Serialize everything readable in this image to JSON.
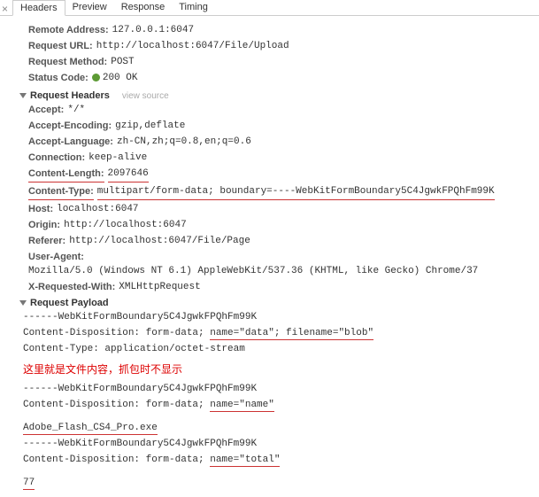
{
  "tabs": {
    "headers": "Headers",
    "preview": "Preview",
    "response": "Response",
    "timing": "Timing"
  },
  "general": {
    "remoteAddress": {
      "label": "Remote Address:",
      "value": "127.0.0.1:6047"
    },
    "requestUrl": {
      "label": "Request URL:",
      "value": "http://localhost:6047/File/Upload"
    },
    "requestMethod": {
      "label": "Request Method:",
      "value": "POST"
    },
    "statusCode": {
      "label": "Status Code:",
      "value": "200 OK"
    }
  },
  "requestHeaders": {
    "title": "Request Headers",
    "viewSource": "view source",
    "accept": {
      "label": "Accept:",
      "value": "*/*"
    },
    "acceptEncoding": {
      "label": "Accept-Encoding:",
      "value": "gzip,deflate"
    },
    "acceptLanguage": {
      "label": "Accept-Language:",
      "value": "zh-CN,zh;q=0.8,en;q=0.6"
    },
    "connection": {
      "label": "Connection:",
      "value": "keep-alive"
    },
    "contentLength": {
      "label": "Content-Length:",
      "value": "2097646"
    },
    "contentType": {
      "label": "Content-Type:",
      "value": "multipart/form-data; boundary=----WebKitFormBoundary5C4JgwkFPQhFm99K"
    },
    "host": {
      "label": "Host:",
      "value": "localhost:6047"
    },
    "origin": {
      "label": "Origin:",
      "value": "http://localhost:6047"
    },
    "referer": {
      "label": "Referer:",
      "value": "http://localhost:6047/File/Page"
    },
    "userAgent": {
      "label": "User-Agent:",
      "value": "Mozilla/5.0 (Windows NT 6.1) AppleWebKit/537.36 (KHTML, like Gecko) Chrome/37"
    },
    "xRequestedWith": {
      "label": "X-Requested-With:",
      "value": "XMLHttpRequest"
    }
  },
  "requestPayload": {
    "title": "Request Payload",
    "boundary1": "------WebKitFormBoundary5C4JgwkFPQhFm99K",
    "disp1_prefix": "Content-Disposition: form-data; ",
    "disp1_name": "name=\"data\"; filename=\"blob\"",
    "ctype1": "Content-Type: application/octet-stream",
    "note": "这里就是文件内容，抓包时不显示",
    "boundary2": "------WebKitFormBoundary5C4JgwkFPQhFm99K",
    "disp2_prefix": "Content-Disposition: form-data; ",
    "disp2_name": "name=\"name\"",
    "filename": "Adobe_Flash_CS4_Pro.exe",
    "boundary3": "------WebKitFormBoundary5C4JgwkFPQhFm99K",
    "disp3_prefix": "Content-Disposition: form-data; ",
    "disp3_name": "name=\"total\"",
    "total": "77"
  }
}
